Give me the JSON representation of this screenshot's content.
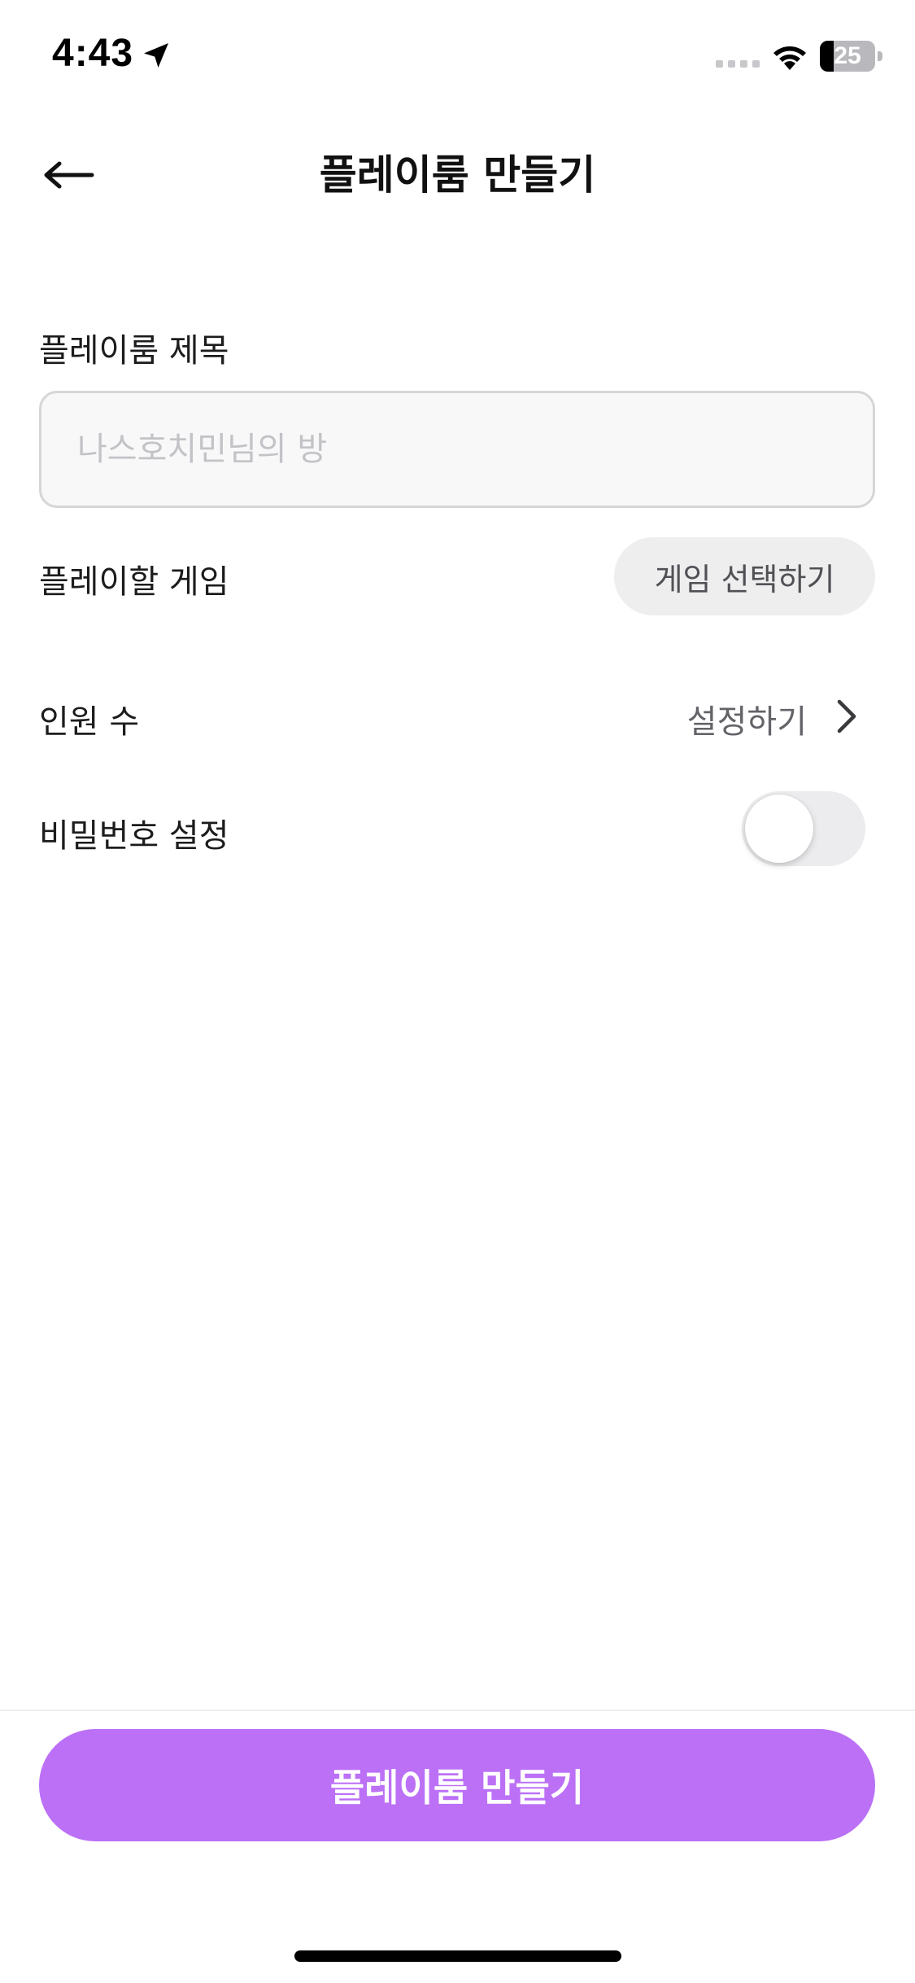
{
  "status_bar": {
    "time": "4:43",
    "battery_level": "25",
    "battery_fraction": 0.25
  },
  "nav": {
    "title": "플레이룸 만들기",
    "back_icon": "arrow-left-icon"
  },
  "form": {
    "title_label": "플레이룸 제목",
    "title_value": "",
    "title_placeholder": "나스호치민님의 방",
    "game_label": "플레이할 게임",
    "game_button_label": "게임 선택하기",
    "people_label": "인원 수",
    "people_value": "설정하기",
    "password_label": "비밀번호 설정",
    "password_enabled": false
  },
  "footer": {
    "create_button_label": "플레이룸 만들기"
  },
  "colors": {
    "accent": "#bb70f6",
    "input_bg": "#f8f8f9",
    "input_border": "#d6d6d9",
    "chip_bg": "#eeeeef",
    "toggle_off": "#ececee"
  }
}
